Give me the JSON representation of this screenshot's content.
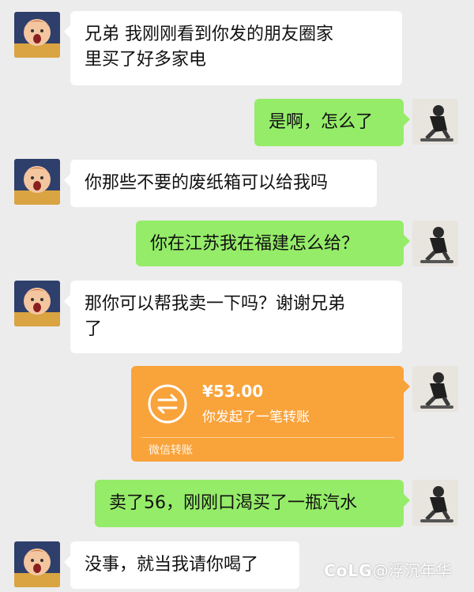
{
  "messages": [
    {
      "side": "left",
      "text_line1": "兄弟  我刚刚看到你发的朋友圈家",
      "text_line2": "里买了好多家电"
    },
    {
      "side": "right",
      "text": "是啊，怎么了"
    },
    {
      "side": "left",
      "text": "你那些不要的废纸箱可以给我吗"
    },
    {
      "side": "right",
      "text": "你在江苏我在福建怎么给？"
    },
    {
      "side": "left",
      "text_line1": "那你可以帮我卖一下吗？谢谢兄弟",
      "text_line2": "了"
    },
    {
      "side": "right",
      "type": "transfer",
      "amount": "¥53.00",
      "description": "你发起了一笔转账",
      "label": "微信转账"
    },
    {
      "side": "right",
      "text": "卖了56，刚刚口渴买了一瓶汽水"
    },
    {
      "side": "left",
      "text": "没事，就当我请你喝了"
    }
  ],
  "watermark": {
    "logo": "CoLG",
    "text": "@浮沉年华"
  },
  "colors": {
    "background": "#ececec",
    "incoming_bubble": "#ffffff",
    "outgoing_bubble": "#95ec69",
    "transfer_card": "#f9a33b"
  },
  "icons": {
    "left_avatar": "crying-child-avatar-icon",
    "right_avatar": "skateboarder-avatar-icon",
    "transfer": "transfer-arrows-icon"
  }
}
